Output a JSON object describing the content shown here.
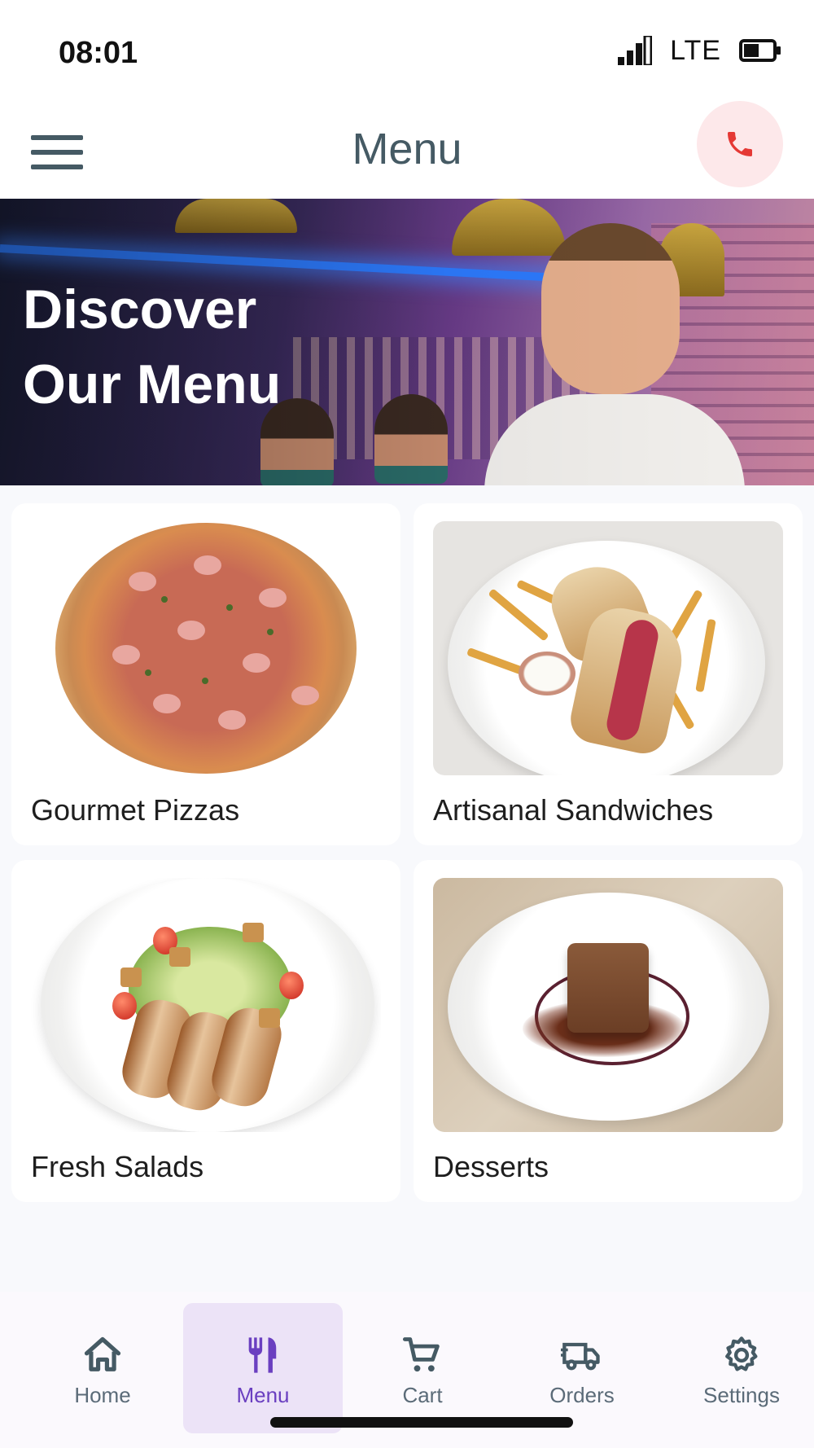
{
  "status_bar": {
    "time": "08:01",
    "network": "LTE"
  },
  "app_bar": {
    "title": "Menu",
    "menu_icon": "hamburger-icon",
    "call_icon": "phone-icon"
  },
  "hero": {
    "title_line1": "Discover",
    "title_line2": "Our Menu"
  },
  "categories": [
    {
      "label": "Gourmet Pizzas"
    },
    {
      "label": "Artisanal Sandwiches"
    },
    {
      "label": "Fresh Salads"
    },
    {
      "label": "Desserts"
    }
  ],
  "bottom_nav": {
    "items": [
      {
        "label": "Home",
        "icon": "home-icon"
      },
      {
        "label": "Menu",
        "icon": "fork-knife-icon",
        "active": true
      },
      {
        "label": "Cart",
        "icon": "cart-icon"
      },
      {
        "label": "Orders",
        "icon": "truck-icon"
      },
      {
        "label": "Settings",
        "icon": "gear-icon"
      }
    ]
  },
  "colors": {
    "accent": "#6a3fc0",
    "active_tab_bg": "#ece3f7",
    "call_bg": "#fde8ea",
    "call_icon": "#e53935",
    "title_text": "#455a64"
  }
}
